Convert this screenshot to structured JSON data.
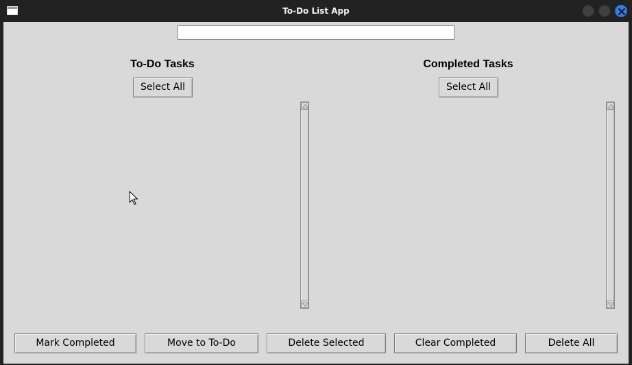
{
  "window": {
    "title": "To-Do List App"
  },
  "entry": {
    "value": ""
  },
  "todo": {
    "heading": "To-Do Tasks",
    "select_all_label": "Select All",
    "items": []
  },
  "completed": {
    "heading": "Completed Tasks",
    "select_all_label": "Select All",
    "items": []
  },
  "actions": {
    "mark_completed": "Mark Completed",
    "move_to_todo": "Move to To-Do",
    "delete_selected": "Delete Selected",
    "clear_completed": "Clear Completed",
    "delete_all": "Delete All"
  },
  "colors": {
    "window_bg": "#d9d9d9",
    "titlebar_bg": "#222222",
    "close_button": "#3a7de0"
  },
  "icons": {
    "app": "window-icon",
    "minimize": "minimize-icon",
    "maximize": "maximize-icon",
    "close": "close-icon",
    "scroll_up": "scroll-up-arrow-icon",
    "scroll_down": "scroll-down-arrow-icon",
    "pointer": "mouse-pointer-icon"
  }
}
